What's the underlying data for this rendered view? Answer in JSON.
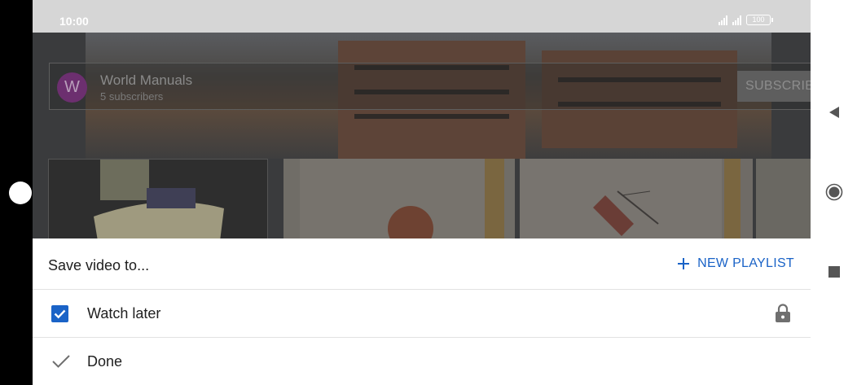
{
  "status_bar": {
    "time": "10:00",
    "battery": "100"
  },
  "channel": {
    "avatar_letter": "W",
    "name": "World Manuals",
    "subscribers": "5 subscribers",
    "subscribe_label": "SUBSCRIBE"
  },
  "sheet": {
    "title": "Save video to...",
    "new_playlist_label": "NEW PLAYLIST",
    "items": [
      {
        "label": "Watch later",
        "checked": true,
        "privacy": "lock-icon"
      }
    ],
    "done_label": "Done"
  },
  "colors": {
    "accent": "#1a63c7",
    "status_bar": "#d6d6d6",
    "overlay": "#3a3b3d"
  },
  "nav": {
    "icons": [
      "back-icon",
      "home-icon",
      "recents-icon"
    ]
  }
}
